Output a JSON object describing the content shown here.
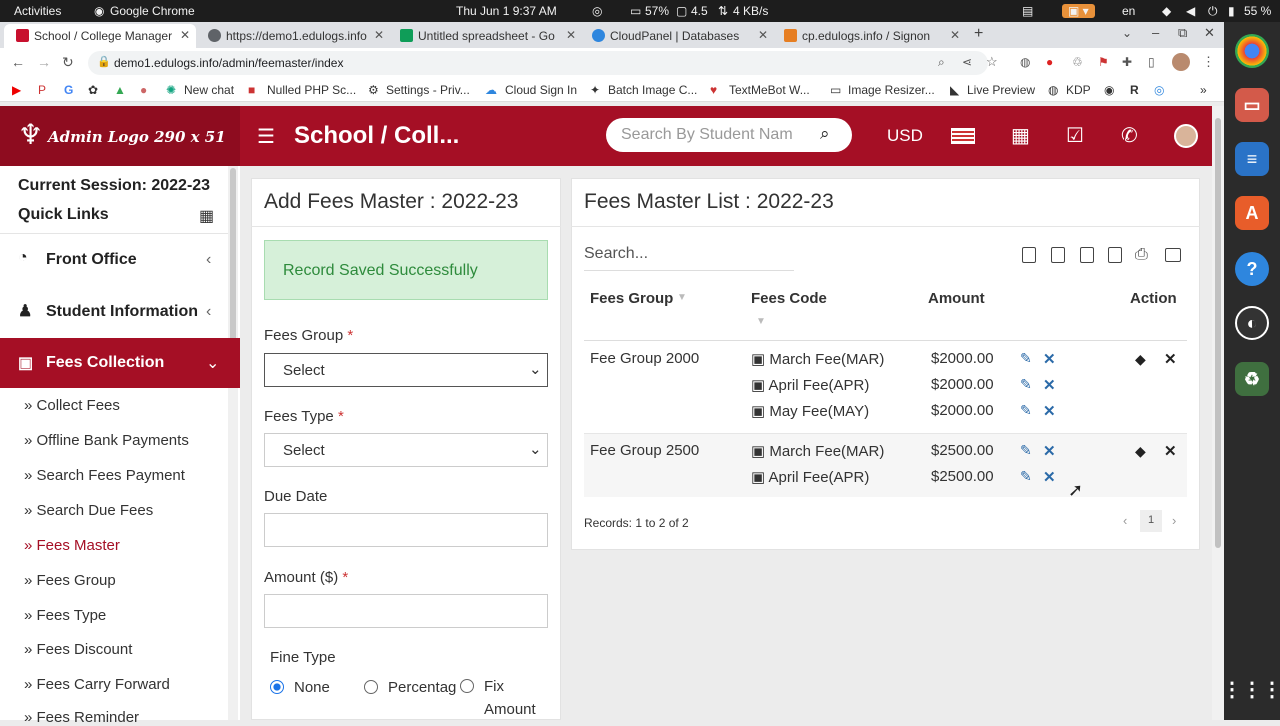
{
  "os": {
    "activities": "Activities",
    "app": "Google Chrome",
    "datetime": "Thu Jun 1   9:37 AM",
    "cpu": "57%",
    "mem": "4.5",
    "net": "4 KB/s",
    "lang": "en",
    "battery": "55 %"
  },
  "tabs": [
    {
      "label": "School / College Manager",
      "fav": "#c8102e"
    },
    {
      "label": "https://demo1.edulogs.info",
      "fav": "#5f6368"
    },
    {
      "label": "Untitled spreadsheet - Go",
      "fav": "#0f9d58"
    },
    {
      "label": "CloudPanel | Databases",
      "fav": "#2e86de"
    },
    {
      "label": "cp.edulogs.info / Signon",
      "fav": "#e67e22"
    }
  ],
  "url": "demo1.edulogs.info/admin/feemaster/index",
  "bookmarks": [
    "New chat",
    "Nulled PHP Sc...",
    "Settings - Priv...",
    "Cloud Sign In",
    "Batch Image C...",
    "TextMeBot W...",
    "Image Resizer...",
    "Live Preview",
    "KDP"
  ],
  "header": {
    "logo": "Admin Logo 290 x 51",
    "title": "School / Coll...",
    "search_placeholder": "Search By Student Nam",
    "currency": "USD"
  },
  "sidebar": {
    "session": "Current Session: 2022-23",
    "quick_links": "Quick Links",
    "front_office": "Front Office",
    "student_info": "Student Information",
    "fees_collection": "Fees Collection",
    "subitems": [
      "Collect Fees",
      "Offline Bank Payments",
      "Search Fees Payment",
      "Search Due Fees",
      "Fees Master",
      "Fees Group",
      "Fees Type",
      "Fees Discount",
      "Fees Carry Forward",
      "Fees Reminder"
    ]
  },
  "form": {
    "title": "Add Fees Master : 2022-23",
    "alert": "Record Saved Successfully",
    "fees_group_label": "Fees Group",
    "fees_group_value": "Select",
    "fees_type_label": "Fees Type",
    "fees_type_value": "Select",
    "due_date_label": "Due Date",
    "amount_label": "Amount ($)",
    "required": "*",
    "fine_type_label": "Fine Type",
    "radio_none": "None",
    "radio_percentage": "Percentag",
    "radio_fix": "Fix",
    "radio_fix2": "Amount"
  },
  "list": {
    "title": "Fees Master List : 2022-23",
    "search_placeholder": "Search...",
    "columns": [
      "Fees Group",
      "Fees Code",
      "Amount",
      "Action"
    ],
    "groups": [
      {
        "name": "Fee Group 2000",
        "rows": [
          {
            "code": "March Fee(MAR)",
            "amount": "$2000.00"
          },
          {
            "code": "April Fee(APR)",
            "amount": "$2000.00"
          },
          {
            "code": "May Fee(MAY)",
            "amount": "$2000.00"
          }
        ]
      },
      {
        "name": "Fee Group 2500",
        "rows": [
          {
            "code": "March Fee(MAR)",
            "amount": "$2500.00"
          },
          {
            "code": "April Fee(APR)",
            "amount": "$2500.00"
          }
        ]
      }
    ],
    "records": "Records: 1 to 2 of 2",
    "page": "1",
    "prev": "‹",
    "next": "›"
  },
  "colors": {
    "brand": "#a50f25",
    "success_bg": "#d6f0d9",
    "success_text": "#2e8b3c"
  }
}
